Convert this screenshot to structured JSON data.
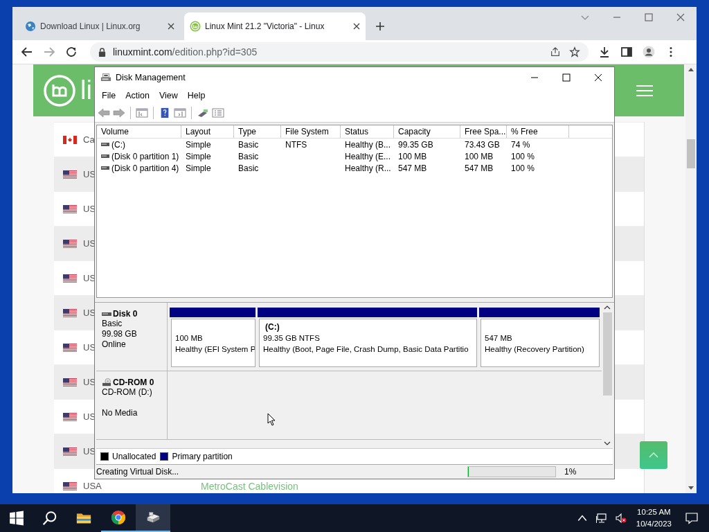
{
  "browser": {
    "tabs": [
      {
        "title": "Download Linux | Linux.org",
        "selected": false
      },
      {
        "title": "Linux Mint 21.2 \"Victoria\" - Linux",
        "selected": true
      }
    ],
    "url_host": "linuxmint.com",
    "url_path": "/edition.php?id=305"
  },
  "web_page": {
    "logo_text": "li",
    "rows": [
      {
        "kind": "canada",
        "country": "Ca"
      },
      {
        "kind": "usa",
        "country": "US"
      },
      {
        "kind": "usa",
        "country": "US"
      },
      {
        "kind": "usa",
        "country": "US"
      },
      {
        "kind": "usa",
        "country": "US"
      },
      {
        "kind": "usa",
        "country": "US"
      },
      {
        "kind": "usa",
        "country": "US"
      },
      {
        "kind": "usa",
        "country": "US"
      },
      {
        "kind": "usa",
        "country": "US"
      },
      {
        "kind": "usa",
        "country": "US"
      },
      {
        "kind": "usa",
        "country": "USA",
        "provider": "MetroCast Cablevision"
      }
    ]
  },
  "window": {
    "title": "Disk Management"
  },
  "menu": [
    "File",
    "Action",
    "View",
    "Help"
  ],
  "volumes": {
    "columns": [
      "Volume",
      "Layout",
      "Type",
      "File System",
      "Status",
      "Capacity",
      "Free Spa...",
      "% Free"
    ],
    "rows": [
      {
        "cells": [
          "(C:)",
          "Simple",
          "Basic",
          "NTFS",
          "Healthy (B...",
          "99.35 GB",
          "73.43 GB",
          "74 %"
        ]
      },
      {
        "cells": [
          "(Disk 0 partition 1)",
          "Simple",
          "Basic",
          "",
          "Healthy (E...",
          "100 MB",
          "100 MB",
          "100 %"
        ]
      },
      {
        "cells": [
          "(Disk 0 partition 4)",
          "Simple",
          "Basic",
          "",
          "Healthy (R...",
          "547 MB",
          "547 MB",
          "100 %"
        ]
      }
    ]
  },
  "disks": [
    {
      "kind": "disk",
      "name": "Disk 0",
      "lines": [
        "Basic",
        "99.98 GB",
        "Online"
      ],
      "partitions": [
        {
          "size": "100 MB",
          "status": "Healthy (EFI System P"
        },
        {
          "name": "(C:)",
          "size": "99.35 GB NTFS",
          "status": "Healthy (Boot, Page File, Crash Dump, Basic Data Partitio"
        },
        {
          "size": "547 MB",
          "status": "Healthy (Recovery Partition)"
        }
      ]
    },
    {
      "kind": "cdrom",
      "name": "CD-ROM 0",
      "lines": [
        "CD-ROM (D:)"
      ],
      "media": "No Media"
    }
  ],
  "legend": [
    {
      "label": "Unallocated",
      "color": "#000000"
    },
    {
      "label": "Primary partition",
      "color": "#000080"
    }
  ],
  "status_bar": {
    "text": "Creating Virtual Disk...",
    "level": 0.01,
    "reading": "1%"
  },
  "taskbar": {
    "apps": [
      {
        "kind": "explorer",
        "running": false,
        "selected": false
      },
      {
        "kind": "chrome",
        "running": true,
        "selected": false
      },
      {
        "kind": "diskmgmt",
        "running": true,
        "selected": true
      }
    ],
    "time": "10:25 AM",
    "date": "10/4/2023"
  }
}
